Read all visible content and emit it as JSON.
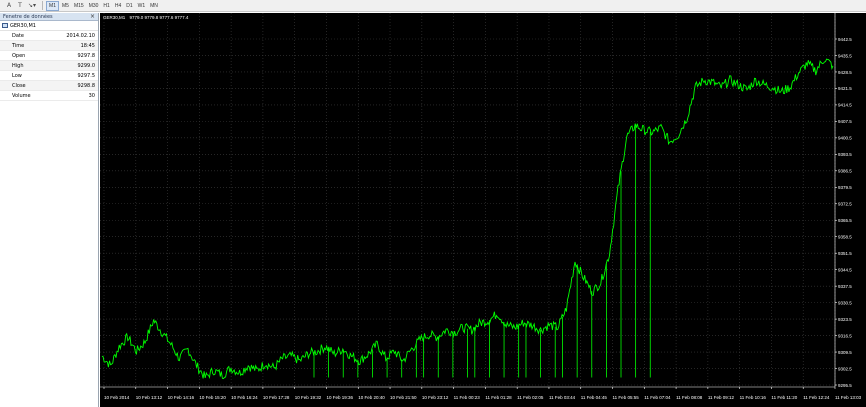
{
  "toolbar": {
    "icons": [
      "text-tool-icon",
      "text-label-icon",
      "arrow-tool-icon",
      "shapes-icon"
    ],
    "timeframes": [
      "M1",
      "M5",
      "M15",
      "M30",
      "H1",
      "H4",
      "D1",
      "W1",
      "MN"
    ],
    "active_timeframe": "M1"
  },
  "data_window": {
    "title": "Fenetre de données",
    "symbol": "GER30,M1",
    "rows": [
      {
        "label": "Date",
        "value": "2014.02.10"
      },
      {
        "label": "Time",
        "value": "18:45"
      },
      {
        "label": "Open",
        "value": "9297.8"
      },
      {
        "label": "High",
        "value": "9299.0"
      },
      {
        "label": "Low",
        "value": "9297.5"
      },
      {
        "label": "Close",
        "value": "9298.8"
      },
      {
        "label": "Volume",
        "value": "30"
      }
    ]
  },
  "chart": {
    "header_symbol": "GER30,M1",
    "header_values": "9779.0 9779.8 9777.6 9777.4",
    "background": "#000000",
    "grid_color": "#3c3c3c",
    "line_color": "#00ff00",
    "text_color": "#ffffff"
  },
  "chart_data": {
    "type": "line",
    "title": "",
    "ylim": [
      9292.0,
      9445.0
    ],
    "y_ticks": [
      "9442.5",
      "9435.5",
      "9428.5",
      "9421.5",
      "9414.5",
      "9407.5",
      "9400.5",
      "9393.5",
      "9386.5",
      "9379.5",
      "9372.5",
      "9365.5",
      "9358.5",
      "9351.5",
      "9344.5",
      "9337.5",
      "9330.5",
      "9323.5",
      "9316.5",
      "9309.5",
      "9302.5",
      "9295.5"
    ],
    "x_ticks": [
      "10 Feb 2014",
      "10 Feb 13:12",
      "10 Feb 14:16",
      "10 Feb 15:20",
      "10 Feb 16:24",
      "10 Feb 17:28",
      "10 Feb 19:32",
      "10 Feb 19:36",
      "10 Feb 20:40",
      "10 Feb 21:50",
      "10 Feb 23:12",
      "11 Feb 00:23",
      "11 Feb 01:28",
      "11 Feb 02:05",
      "11 Feb 03:44",
      "11 Feb 04:45",
      "11 Feb 05:55",
      "11 Feb 07:04",
      "11 Feb 08:08",
      "11 Feb 09:12",
      "11 Feb 10:16",
      "11 Feb 11:20",
      "11 Feb 12:24",
      "11 Feb 13:03"
    ],
    "values": [
      9305,
      9301,
      9309,
      9313,
      9307,
      9311,
      9320,
      9315,
      9310,
      9304,
      9308,
      9301,
      9296,
      9299,
      9297,
      9300,
      9298,
      9301,
      9299,
      9302,
      9300,
      9304,
      9305,
      9303,
      9306,
      9307,
      9309,
      9306,
      9308,
      9305,
      9303,
      9306,
      9310,
      9304,
      9307,
      9303,
      9308,
      9312,
      9314,
      9313,
      9316,
      9315,
      9317,
      9316,
      9319,
      9320,
      9323,
      9318,
      9317,
      9319,
      9318,
      9316,
      9318,
      9317,
      9325,
      9345,
      9338,
      9332,
      9336,
      9348,
      9375,
      9397,
      9402,
      9400,
      9399,
      9401,
      9395,
      9398,
      9405,
      9418,
      9421,
      9420,
      9418,
      9421,
      9419,
      9417,
      9421,
      9419,
      9418,
      9416,
      9418,
      9424,
      9428,
      9425,
      9430,
      9427
    ],
    "drop_positions": [
      0.29,
      0.31,
      0.33,
      0.35,
      0.37,
      0.39,
      0.41,
      0.43,
      0.44,
      0.46,
      0.48,
      0.5,
      0.51,
      0.53,
      0.55,
      0.57,
      0.58,
      0.6,
      0.62,
      0.63,
      0.65,
      0.67,
      0.69,
      0.71,
      0.73,
      0.75
    ]
  }
}
